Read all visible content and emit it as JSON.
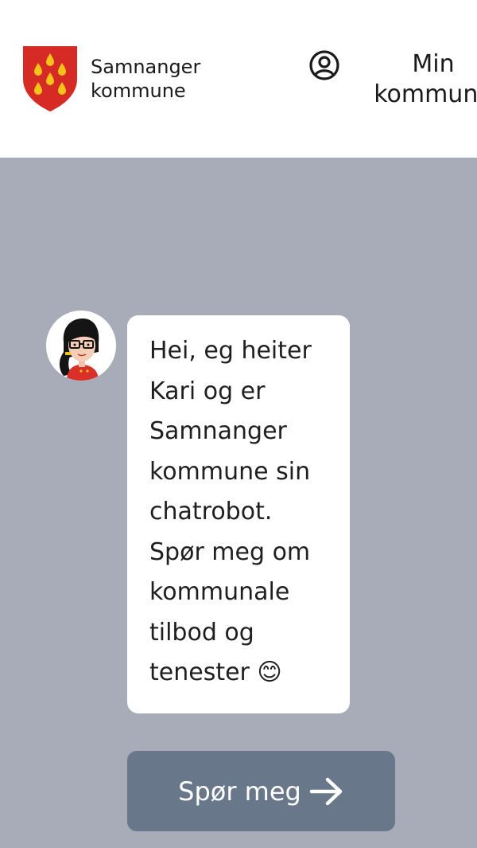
{
  "header": {
    "brand_line1": "Samnanger",
    "brand_line2": "kommune",
    "my_area_line1": "Min",
    "my_area_line2": "kommune",
    "accent_red": "#d62b24",
    "accent_gold": "#f3c21b"
  },
  "chat": {
    "avatar_icon": "chatbot-avatar",
    "message_lines": [
      "Hei, eg heiter",
      "Kari og er",
      "Samnanger",
      "kommune sin",
      "chatrobot.",
      "Spør meg om",
      "kommunale",
      "tilbod og",
      "tenester 😊"
    ],
    "button_label": "Spør meg",
    "button_icon": "arrow-right-icon",
    "background": "#a7acb8",
    "button_color": "#68788a"
  }
}
